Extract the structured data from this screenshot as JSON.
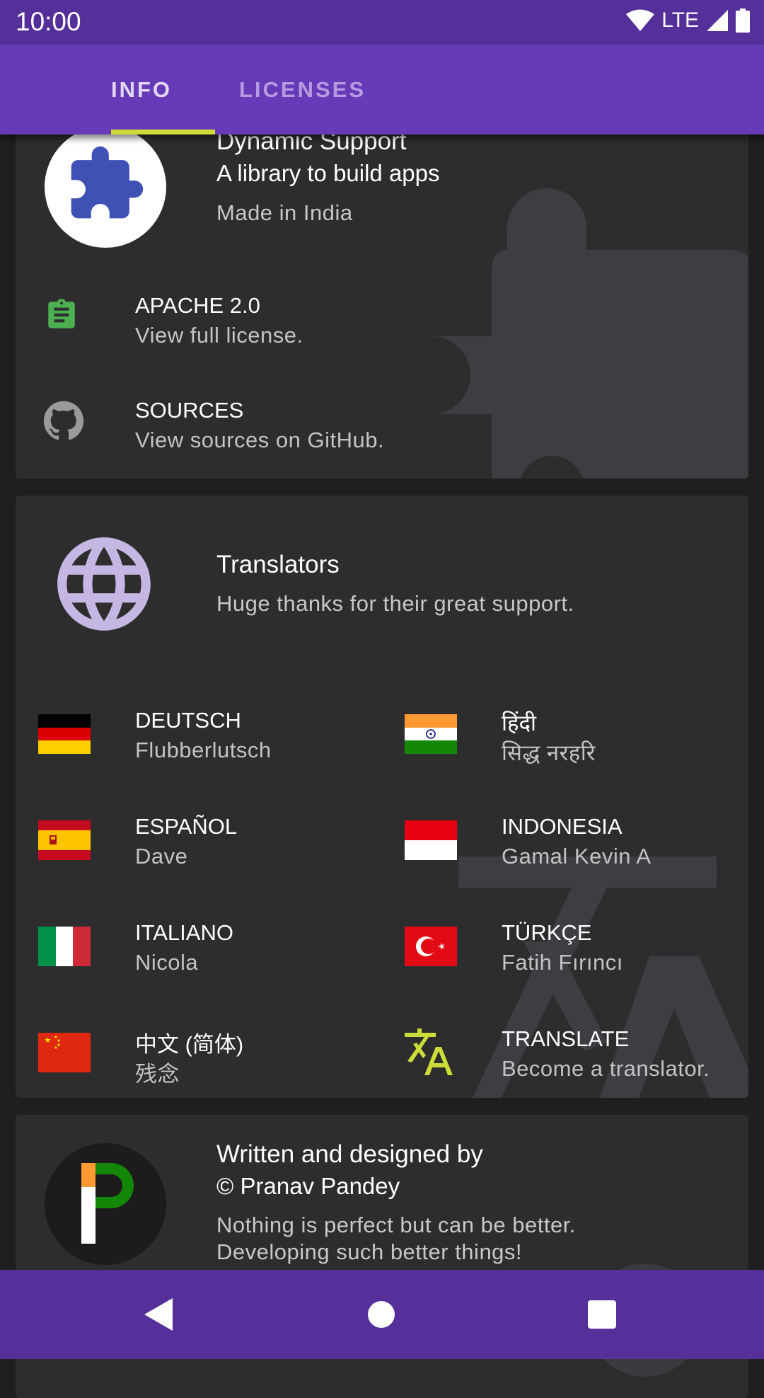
{
  "status_bar": {
    "time": "10:00",
    "network": "LTE"
  },
  "tabs": [
    {
      "label": "INFO",
      "selected": true
    },
    {
      "label": "LICENSES",
      "selected": false
    }
  ],
  "colors": {
    "primary": "#673ab7",
    "status_bar": "#55309a",
    "accent": "#cddc39",
    "card": "#2d2d2d",
    "background": "#1f1f1f"
  },
  "app_card": {
    "title": "Dynamic Support",
    "subtitle": "A library to build apps",
    "description": "Made in India",
    "items": [
      {
        "icon": "clipboard-icon",
        "title": "APACHE 2.0",
        "subtitle": "View full license."
      },
      {
        "icon": "github-icon",
        "title": "SOURCES",
        "subtitle": "View sources on GitHub."
      }
    ]
  },
  "translators_card": {
    "title": "Translators",
    "subtitle": "Huge thanks for their great support.",
    "items": [
      {
        "flag": "germany-flag-icon",
        "language": "DEUTSCH",
        "name": "Flubberlutsch"
      },
      {
        "flag": "india-flag-icon",
        "language": "हिंदी",
        "name": "सिद्ध नरहरि"
      },
      {
        "flag": "spain-flag-icon",
        "language": "ESPAÑOL",
        "name": "Dave"
      },
      {
        "flag": "indonesia-flag-icon",
        "language": "INDONESIA",
        "name": "Gamal Kevin A"
      },
      {
        "flag": "italy-flag-icon",
        "language": "ITALIANO",
        "name": "Nicola"
      },
      {
        "flag": "turkey-flag-icon",
        "language": "TÜRKÇE",
        "name": "Fatih Fırıncı"
      },
      {
        "flag": "china-flag-icon",
        "language": "中文 (简体)",
        "name": "残念"
      },
      {
        "flag": "translate-icon",
        "language": "TRANSLATE",
        "name": "Become a translator."
      }
    ]
  },
  "author_card": {
    "title": "Written and designed by",
    "subtitle": "© Pranav Pandey",
    "description_line1": "Nothing is perfect but can be better.",
    "description_line2": "Developing such better things!"
  }
}
